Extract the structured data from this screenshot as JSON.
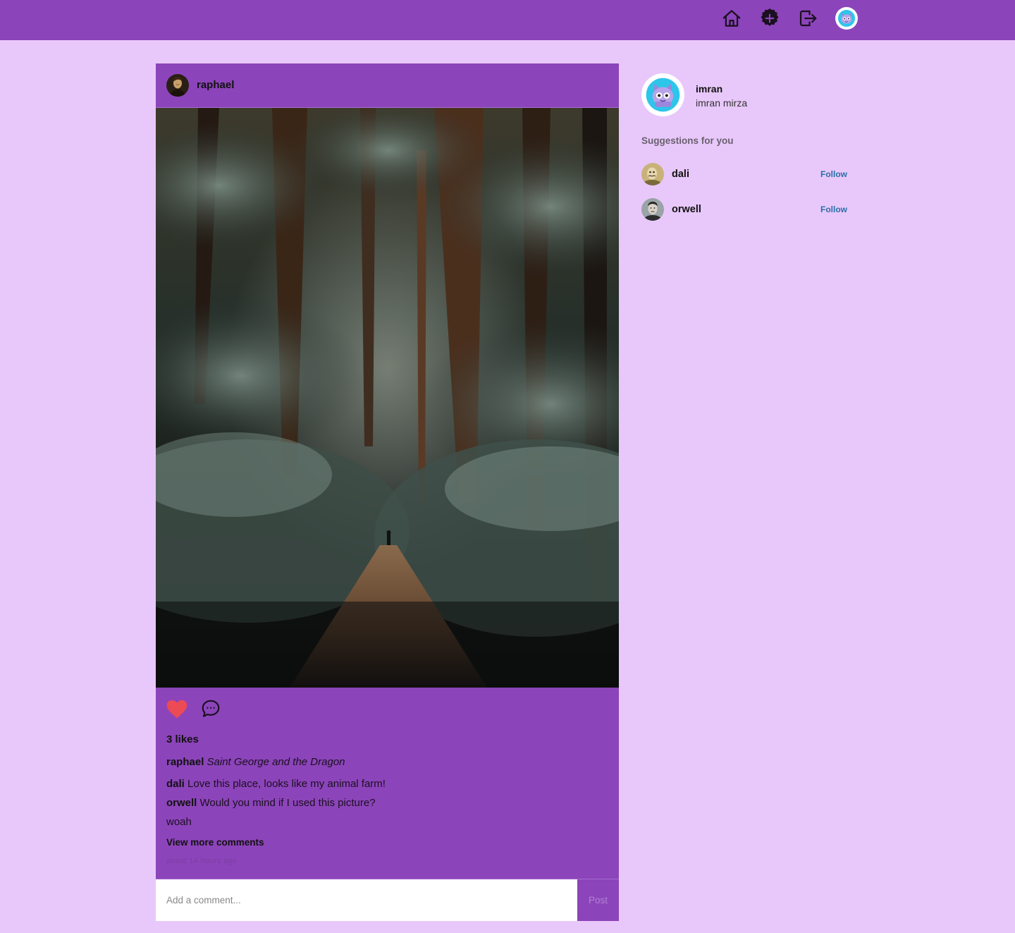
{
  "header": {
    "home_icon": "home-icon",
    "add_icon": "plus-circle-icon",
    "logout_icon": "sign-out-icon",
    "avatar_icon": "robot-cat-avatar"
  },
  "post": {
    "username": "raphael",
    "likes": "3 likes",
    "liked": true,
    "caption": {
      "username": "raphael",
      "text": "Saint George and the Dragon"
    },
    "comments": [
      {
        "username": "dali",
        "text": "Love this place, looks like my animal farm!"
      },
      {
        "username": "orwell",
        "text": "Would you mind if I used this picture?"
      },
      {
        "username": "",
        "text": "woah"
      }
    ],
    "view_more": "View more comments",
    "timestamp": "about 14 hours ago",
    "comment_placeholder": "Add a comment...",
    "post_button": "Post"
  },
  "sidebar": {
    "username": "imran",
    "full_name": "imran mirza",
    "suggestions_title": "Suggestions for you",
    "suggestions": [
      {
        "username": "dali",
        "follow_label": "Follow"
      },
      {
        "username": "orwell",
        "follow_label": "Follow"
      }
    ]
  },
  "colors": {
    "background": "#e8c8fa",
    "header": "#8c44ba",
    "card": "#8c44ba",
    "like": "#ec4a55",
    "follow": "#2b6ea7"
  }
}
